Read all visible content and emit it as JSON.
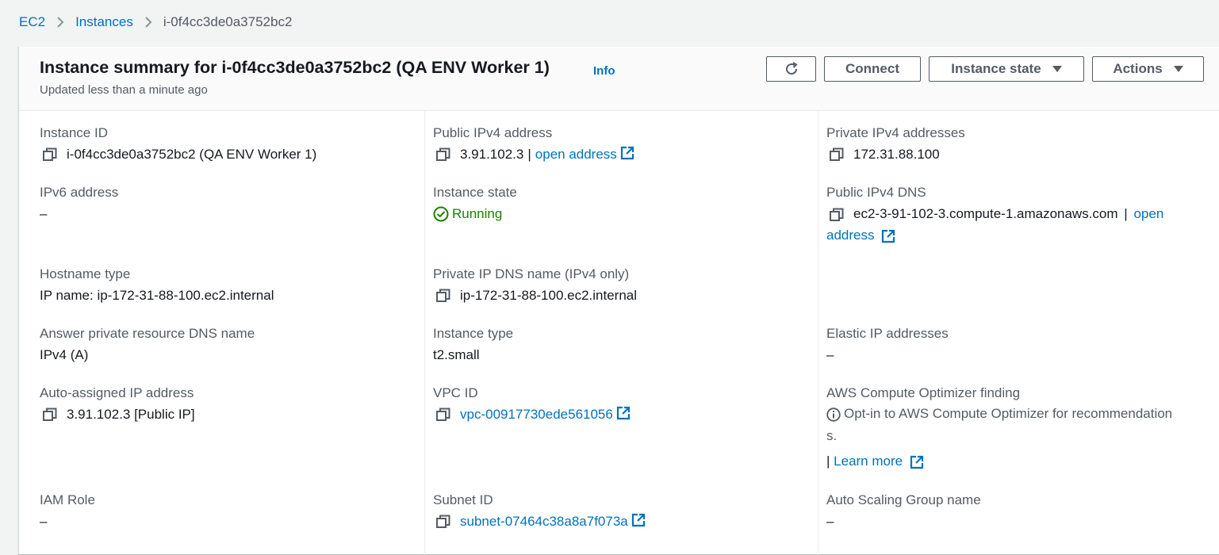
{
  "breadcrumb": {
    "root": "EC2",
    "parent": "Instances",
    "current": "i-0f4cc3de0a3752bc2"
  },
  "header": {
    "title": "Instance summary for i-0f4cc3de0a3752bc2 (QA ENV Worker 1)",
    "info": "Info",
    "subtitle": "Updated less than a minute ago",
    "connect_label": "Connect",
    "instance_state_label": "Instance state",
    "actions_label": "Actions"
  },
  "fields": {
    "instance_id": {
      "label": "Instance ID",
      "value": "i-0f4cc3de0a3752bc2 (QA ENV Worker 1)"
    },
    "public_ipv4": {
      "label": "Public IPv4 address",
      "value": "3.91.102.3",
      "sep": "|",
      "link": "open address"
    },
    "private_ipv4": {
      "label": "Private IPv4 addresses",
      "value": "172.31.88.100"
    },
    "ipv6": {
      "label": "IPv6 address",
      "value": "–"
    },
    "instance_state": {
      "label": "Instance state",
      "value": "Running"
    },
    "public_dns": {
      "label": "Public IPv4 DNS",
      "value": "ec2-3-91-102-3.compute-1.amazonaws.com",
      "sep": "|",
      "link1": "open",
      "link2": "address"
    },
    "hostname_type": {
      "label": "Hostname type",
      "value": "IP name: ip-172-31-88-100.ec2.internal"
    },
    "private_dns": {
      "label": "Private IP DNS name (IPv4 only)",
      "value": "ip-172-31-88-100.ec2.internal"
    },
    "answer_dns": {
      "label": "Answer private resource DNS name",
      "value": "IPv4 (A)"
    },
    "instance_type": {
      "label": "Instance type",
      "value": "t2.small"
    },
    "elastic_ip": {
      "label": "Elastic IP addresses",
      "value": "–"
    },
    "auto_ip": {
      "label": "Auto-assigned IP address",
      "value": "3.91.102.3 [Public IP]"
    },
    "vpc_id": {
      "label": "VPC ID",
      "value": "vpc-00917730ede561056"
    },
    "optimizer": {
      "label": "AWS Compute Optimizer finding",
      "line1": "Opt-in to AWS Compute Optimizer for recommendation",
      "line2": "s.",
      "sep": "|",
      "link": "Learn more"
    },
    "iam_role": {
      "label": "IAM Role",
      "value": "–"
    },
    "subnet_id": {
      "label": "Subnet ID",
      "value": "subnet-07464c38a8a7f073a"
    },
    "asg_name": {
      "label": "Auto Scaling Group name",
      "value": "–"
    }
  },
  "colors": {
    "link": "#0073bb",
    "running": "#1d8102",
    "label": "#545b64",
    "text": "#16191f"
  },
  "icons": [
    "chevron-right-icon",
    "refresh-icon",
    "caret-down-icon",
    "copy-icon",
    "external-link-icon",
    "check-circle-icon",
    "info-circle-icon"
  ]
}
